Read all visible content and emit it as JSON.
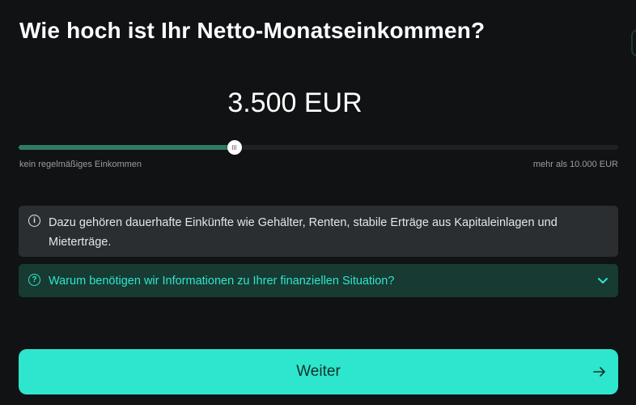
{
  "question": {
    "title": "Wie hoch ist Ihr Netto-Monatseinkommen?"
  },
  "income": {
    "display": "3.500 EUR",
    "value": 3500,
    "slider_fraction": 0.36,
    "min_label": "kein regelmäßiges Einkommen",
    "max_label": "mehr als 10.000 EUR"
  },
  "info": {
    "icon": "info-icon",
    "text": "Dazu gehören dauerhafte Einkünfte wie Gehälter, Renten, stabile Erträge aus Kapitaleinlagen und Mieterträge."
  },
  "faq": {
    "icon": "question-icon",
    "label": "Warum benötigen wir Informationen zu Ihrer finanziellen Situation?"
  },
  "cta": {
    "label": "Weiter",
    "icon": "arrow-right-icon"
  },
  "colors": {
    "background": "#111213",
    "accent": "#2ee6cd",
    "slider_fill": "#2e7a64",
    "info_bg": "#2b2e30",
    "faq_bg": "#173a32"
  }
}
